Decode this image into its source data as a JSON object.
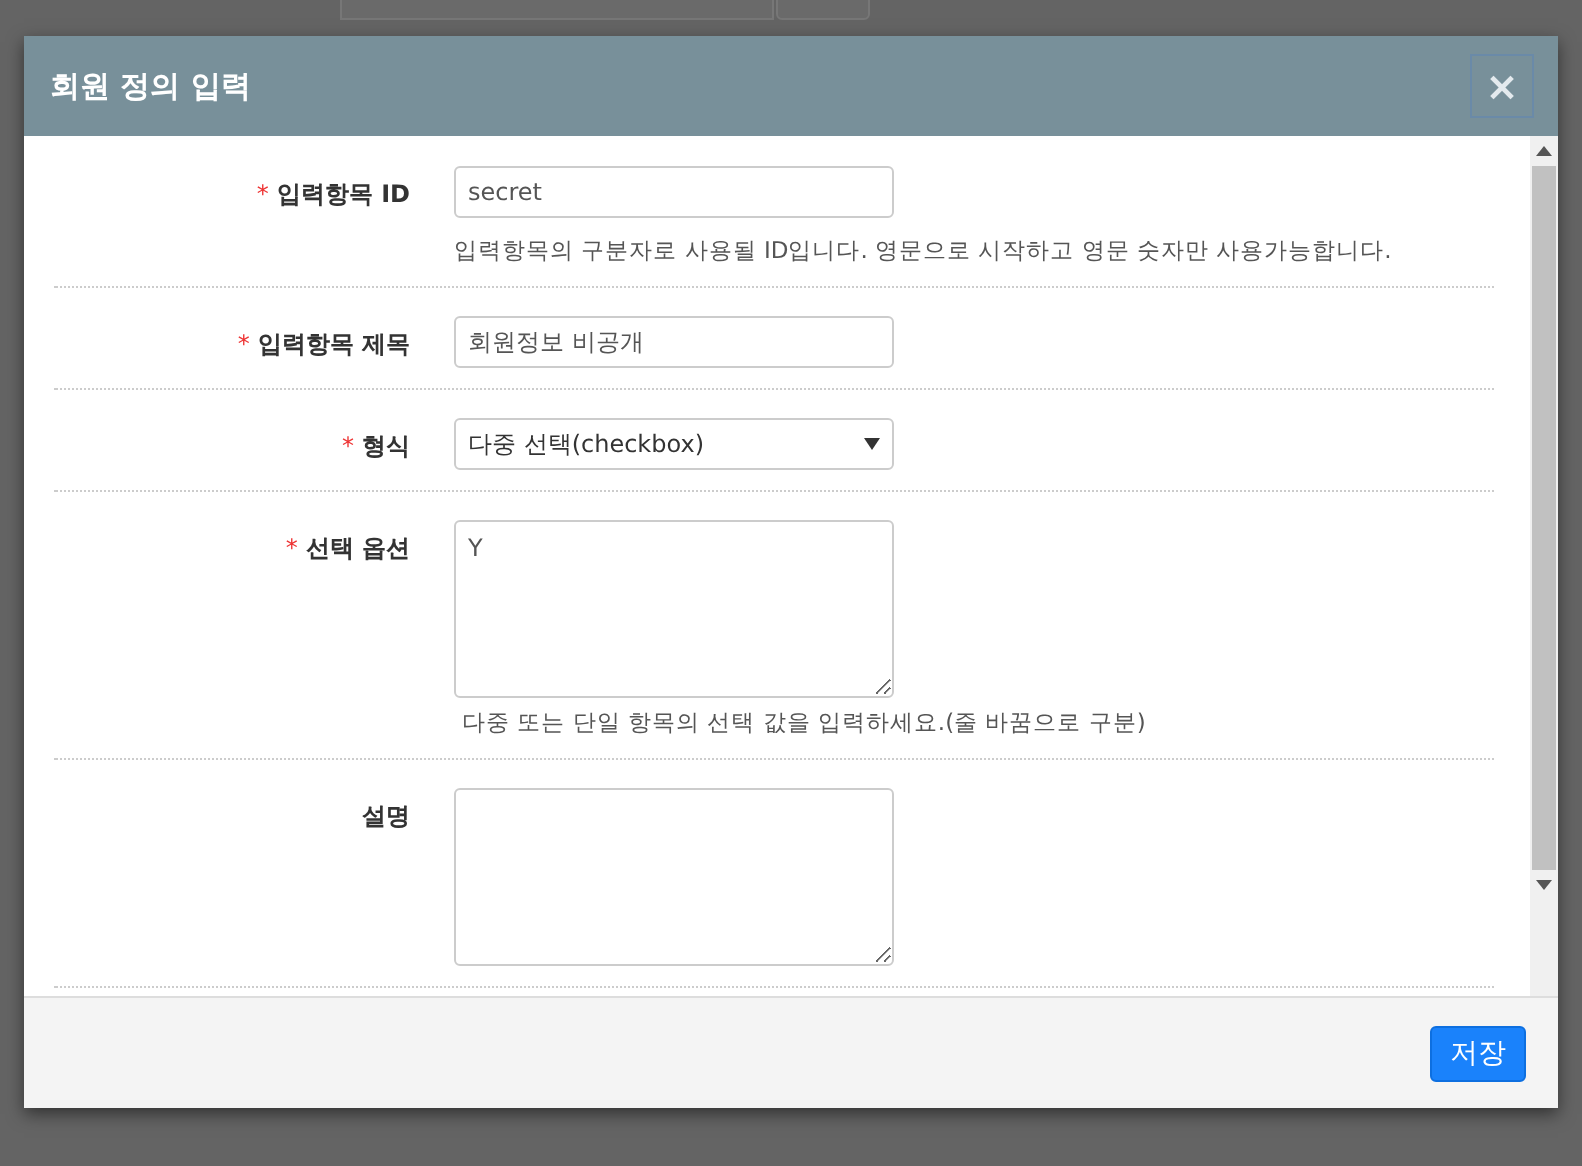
{
  "dialog": {
    "title": "회원 정의 입력",
    "close": "×"
  },
  "fields": [
    {
      "label": "입력항목 ID",
      "marker": "*",
      "kind": "text",
      "value": "secret",
      "help": "입력항목의 구분자로 사용될 ID입니다. 영문으로 시작하고 영문 숫자만 사용가능합니다."
    },
    {
      "label": "입력항목 제목",
      "marker": "*",
      "kind": "text",
      "value": "회원정보 비공개"
    },
    {
      "label": "형식",
      "marker": "*",
      "kind": "select",
      "value": "다중 선택(checkbox)"
    },
    {
      "label": "선택 옵션",
      "marker": "*",
      "kind": "textarea",
      "value": "Y",
      "help": "다중 또는 단일 항목의 선택 값을 입력하세요.(줄 바꿈으로 구분)"
    },
    {
      "label": "설명",
      "kind": "textarea"
    }
  ],
  "buttons": [
    {
      "label": "저장"
    }
  ]
}
